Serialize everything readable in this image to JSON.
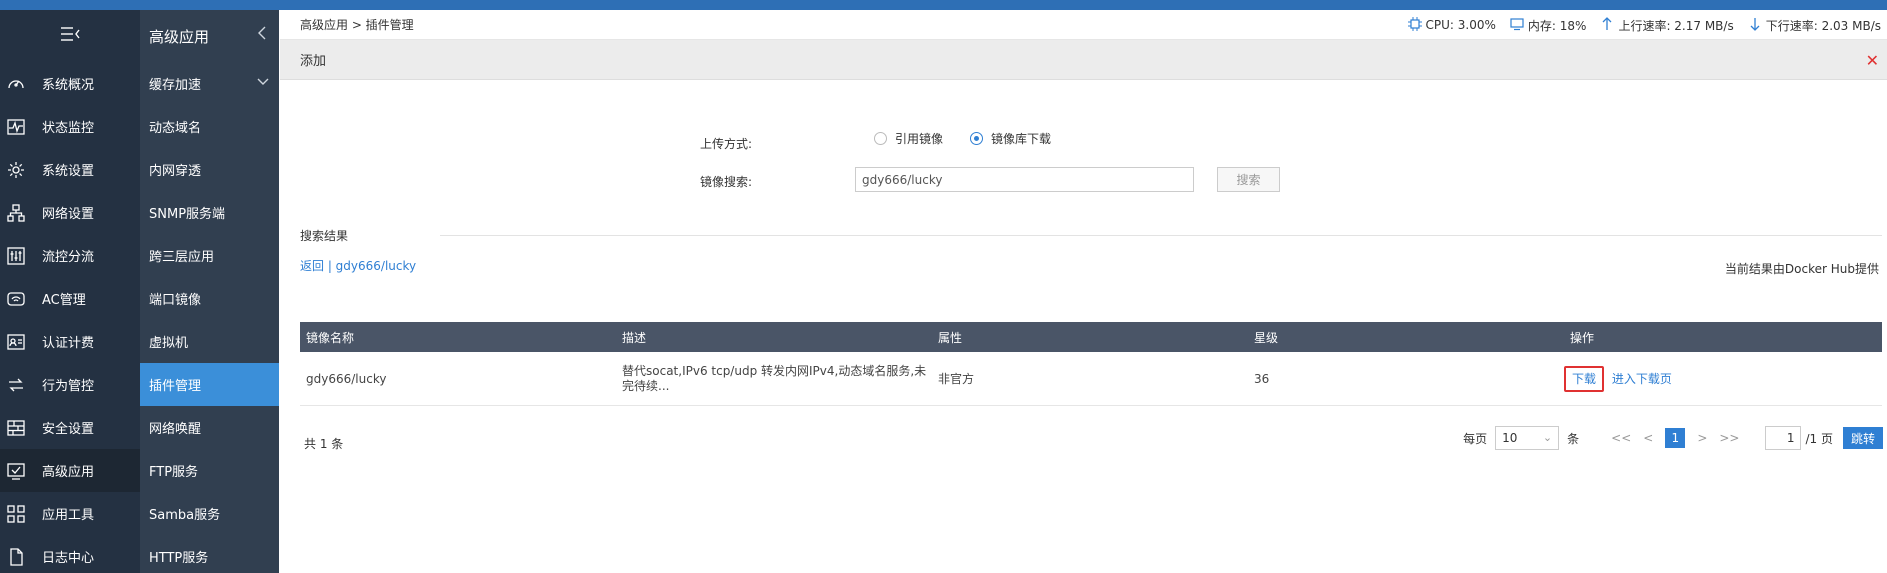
{
  "nav_primary": {
    "items": [
      {
        "label": "系统概况",
        "icon": "gauge-icon"
      },
      {
        "label": "状态监控",
        "icon": "pulse-icon"
      },
      {
        "label": "系统设置",
        "icon": "gear-icon"
      },
      {
        "label": "网络设置",
        "icon": "network-icon"
      },
      {
        "label": "流控分流",
        "icon": "sliders-icon"
      },
      {
        "label": "AC管理",
        "icon": "wifi-icon"
      },
      {
        "label": "认证计费",
        "icon": "id-card-icon"
      },
      {
        "label": "行为管控",
        "icon": "swap-icon"
      },
      {
        "label": "安全设置",
        "icon": "firewall-icon"
      },
      {
        "label": "高级应用",
        "icon": "check-screen-icon"
      },
      {
        "label": "应用工具",
        "icon": "apps-icon"
      },
      {
        "label": "日志中心",
        "icon": "document-icon"
      }
    ]
  },
  "nav_secondary": {
    "title": "高级应用",
    "items": [
      {
        "label": "缓存加速"
      },
      {
        "label": "动态域名"
      },
      {
        "label": "内网穿透"
      },
      {
        "label": "SNMP服务端"
      },
      {
        "label": "跨三层应用"
      },
      {
        "label": "端口镜像"
      },
      {
        "label": "虚拟机"
      },
      {
        "label": "插件管理"
      },
      {
        "label": "网络唤醒"
      },
      {
        "label": "FTP服务"
      },
      {
        "label": "Samba服务"
      },
      {
        "label": "HTTP服务"
      }
    ]
  },
  "header": {
    "breadcrumb": "高级应用 > 插件管理",
    "cpu": "CPU: 3.00%",
    "mem": "内存: 18%",
    "up": "上行速率: 2.17 MB/s",
    "down": "下行速率: 2.03 MB/s"
  },
  "panel": {
    "title": "添加"
  },
  "form": {
    "upload_label": "上传方式:",
    "option_ref": "引用镜像",
    "option_repo": "镜像库下载",
    "search_label": "镜像搜索:",
    "search_value": "gdy666/lucky",
    "search_button": "搜索"
  },
  "results": {
    "title": "搜索结果",
    "back": "返回 | gdy666/lucky",
    "provider": "当前结果由Docker Hub提供",
    "columns": [
      "镜像名称",
      "描述",
      "属性",
      "星级",
      "操作"
    ],
    "rows": [
      {
        "name": "gdy666/lucky",
        "desc_line1": "替代socat,IPv6 tcp/udp 转发内网IPv4,动态域名服务,未",
        "desc_line2": "完待续...",
        "attr": "非官方",
        "stars": "36",
        "action_download": "下载",
        "action_page": "进入下载页"
      }
    ],
    "total": "共 1 条"
  },
  "pagination": {
    "per_page_label": "每页",
    "per_page_value": "10",
    "unit": "条",
    "first": "<<",
    "prev": "<",
    "current": "1",
    "next": ">",
    "last": ">>",
    "page_input": "1",
    "page_total": "/1 页",
    "jump": "跳转"
  },
  "colors": {
    "accent": "#2f7fd3",
    "nav_primary_bg": "#243142",
    "nav_secondary_bg": "#313f50",
    "table_header_bg": "#4a5567",
    "highlight_red": "#e03131"
  }
}
